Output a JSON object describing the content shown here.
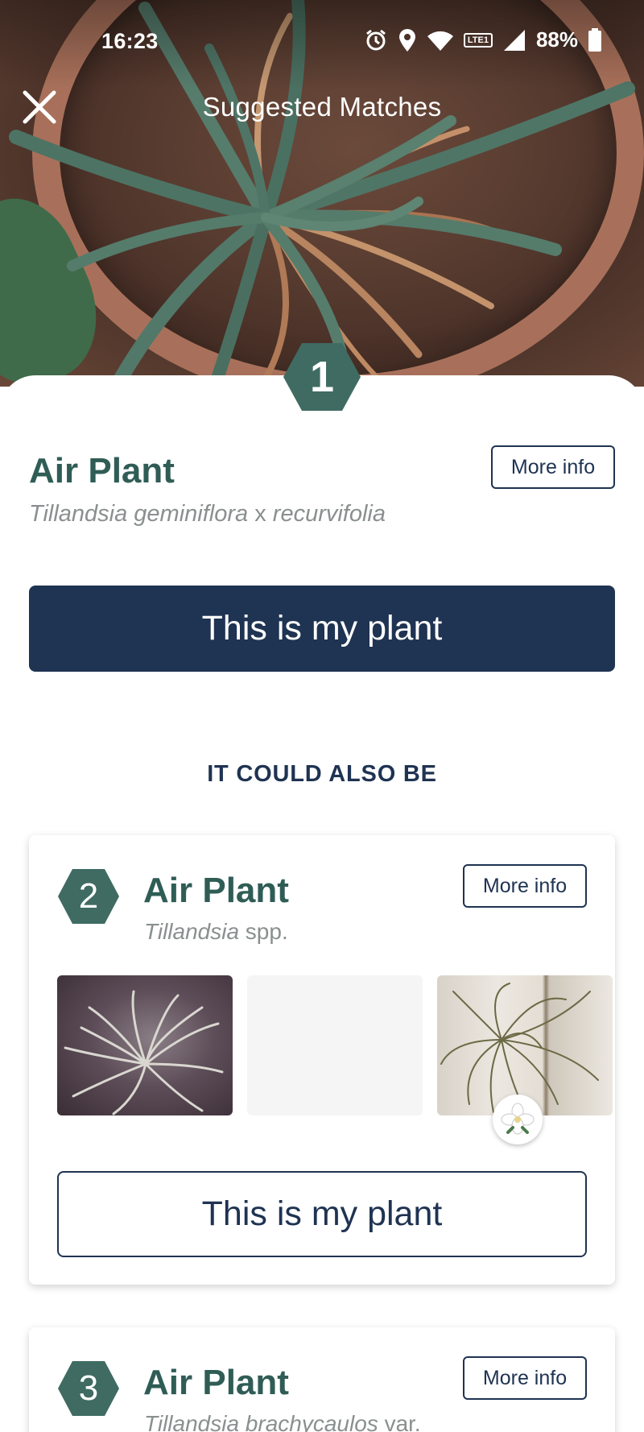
{
  "status_bar": {
    "time": "16:23",
    "battery": "88%",
    "network_badge": "LTE1",
    "icons": [
      "alarm-icon",
      "location-icon",
      "wifi-icon",
      "volte-icon",
      "signal-icon",
      "battery-icon"
    ]
  },
  "header": {
    "title": "Suggested Matches",
    "close_icon": "close-icon"
  },
  "top_match": {
    "rank": "1",
    "common_name": "Air Plant",
    "scientific_genus_1": "Tillandsia geminiflora",
    "scientific_connector": " x ",
    "scientific_genus_2": "recurvifolia",
    "more_info_label": "More info",
    "confirm_label": "This is my plant"
  },
  "alternatives_heading": "IT COULD ALSO BE",
  "alternatives": [
    {
      "rank": "2",
      "common_name": "Air Plant",
      "scientific_italic": "Tillandsia",
      "scientific_plain": " spp.",
      "more_info_label": "More info",
      "confirm_label": "This is my plant",
      "thumbnails": [
        "air-plant-photo-1",
        "loading-placeholder",
        "air-plant-photo-3"
      ],
      "badge_icon": "gardenia-flower-icon"
    },
    {
      "rank": "3",
      "common_name": "Air Plant",
      "scientific_italic": "Tillandsia brachycaulos",
      "scientific_plain": " var.",
      "more_info_label": "More info"
    }
  ],
  "colors": {
    "brand_navy": "#1f3352",
    "brand_green": "#2f5d56",
    "hex_badge": "#3f6b62",
    "muted_text": "#8a8f8f"
  }
}
